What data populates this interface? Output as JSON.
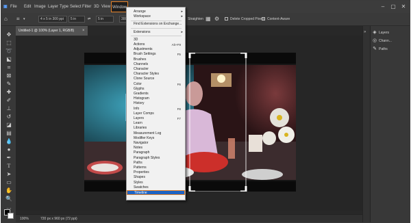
{
  "menubar": {
    "items": [
      "File",
      "Edit",
      "Image",
      "Layer",
      "Type",
      "Select",
      "Filter",
      "3D",
      "View",
      "Window"
    ],
    "active": "Window"
  },
  "options": {
    "ratio": "4 x 5 in 300 ppi",
    "swap": "⇄",
    "value1": "5 in",
    "value2": "300",
    "straighten": "Straighten",
    "delete_cropped": "Delete Cropped Pixels",
    "content_aware": "Content-Aware"
  },
  "document": {
    "tab": "Untitled-1 @ 100% (Layer 1, RGB/8)"
  },
  "status": {
    "zoom": "100%",
    "size": "720 px x 960 px (72 ppi)"
  },
  "panels": {
    "items": [
      "Layers",
      "Chann...",
      "Paths"
    ]
  },
  "window_menu": {
    "items": [
      {
        "label": "Arrange",
        "submenu": true
      },
      {
        "label": "Workspace",
        "submenu": true
      },
      {
        "label": "Find Extensions on Exchange..."
      },
      {
        "label": "Extensions",
        "submenu": true
      },
      {
        "label": "3D"
      },
      {
        "label": "Actions",
        "shortcut": "Alt+F9"
      },
      {
        "label": "Adjustments"
      },
      {
        "label": "Brush Settings",
        "shortcut": "F5"
      },
      {
        "label": "Brushes"
      },
      {
        "label": "Channels"
      },
      {
        "label": "Character"
      },
      {
        "label": "Character Styles"
      },
      {
        "label": "Clone Source"
      },
      {
        "label": "Color",
        "shortcut": "F6"
      },
      {
        "label": "Glyphs"
      },
      {
        "label": "Gradients"
      },
      {
        "label": "Histogram"
      },
      {
        "label": "History"
      },
      {
        "label": "Info",
        "shortcut": "F8"
      },
      {
        "label": "Layer Comps"
      },
      {
        "label": "Layers",
        "shortcut": "F7"
      },
      {
        "label": "Learn"
      },
      {
        "label": "Libraries"
      },
      {
        "label": "Measurement Log"
      },
      {
        "label": "Modifier Keys"
      },
      {
        "label": "Navigator"
      },
      {
        "label": "Notes"
      },
      {
        "label": "Paragraph"
      },
      {
        "label": "Paragraph Styles"
      },
      {
        "label": "Paths"
      },
      {
        "label": "Patterns"
      },
      {
        "label": "Properties"
      },
      {
        "label": "Shapes"
      },
      {
        "label": "Styles"
      },
      {
        "label": "Swatches"
      },
      {
        "label": "Timeline",
        "highlighted": true
      }
    ]
  },
  "colors": {
    "accent_outline": "#e5832a",
    "highlight": "#1f63c2"
  }
}
